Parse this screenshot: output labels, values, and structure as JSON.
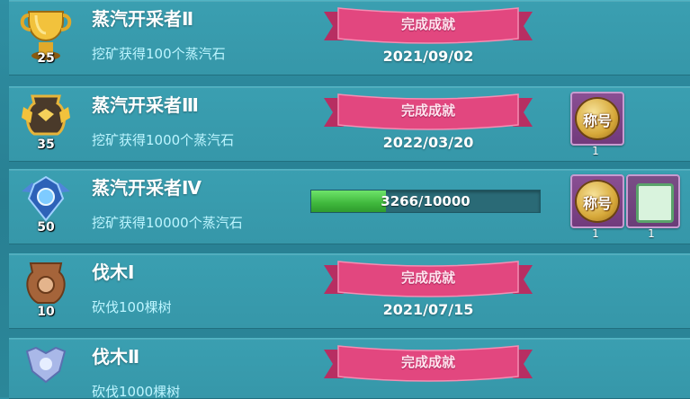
{
  "rows": [
    {
      "title": "蒸汽开采者Ⅱ",
      "desc": "挖矿获得100个蒸汽石",
      "level": "25",
      "status": "完成成就",
      "date": "2021/09/02",
      "badge": "gold-trophy-icon"
    },
    {
      "title": "蒸汽开采者Ⅲ",
      "desc": "挖矿获得1000个蒸汽石",
      "level": "35",
      "status": "完成成就",
      "date": "2022/03/20",
      "badge": "gold-vase-icon",
      "rewards": [
        {
          "label": "称号",
          "count": "1"
        }
      ]
    },
    {
      "title": "蒸汽开采者Ⅳ",
      "desc": "挖矿获得10000个蒸汽石",
      "level": "50",
      "badge": "blue-crest-icon",
      "progress": {
        "text": "3266/10000",
        "value": 3266,
        "max": 10000
      },
      "rewards": [
        {
          "label": "称号",
          "count": "1"
        },
        {
          "label": "",
          "count": "1"
        }
      ]
    },
    {
      "title": "伐木Ⅰ",
      "desc": "砍伐100棵树",
      "level": "10",
      "status": "完成成就",
      "date": "2021/07/15",
      "badge": "bronze-vase-icon"
    },
    {
      "title": "伐木Ⅱ",
      "desc": "砍伐1000棵树",
      "status": "完成成就",
      "badge": "silver-trophy-icon"
    }
  ],
  "colors": {
    "ribbon": "#e2477f",
    "progress": "#4cc447",
    "panel": "#3697a9"
  }
}
